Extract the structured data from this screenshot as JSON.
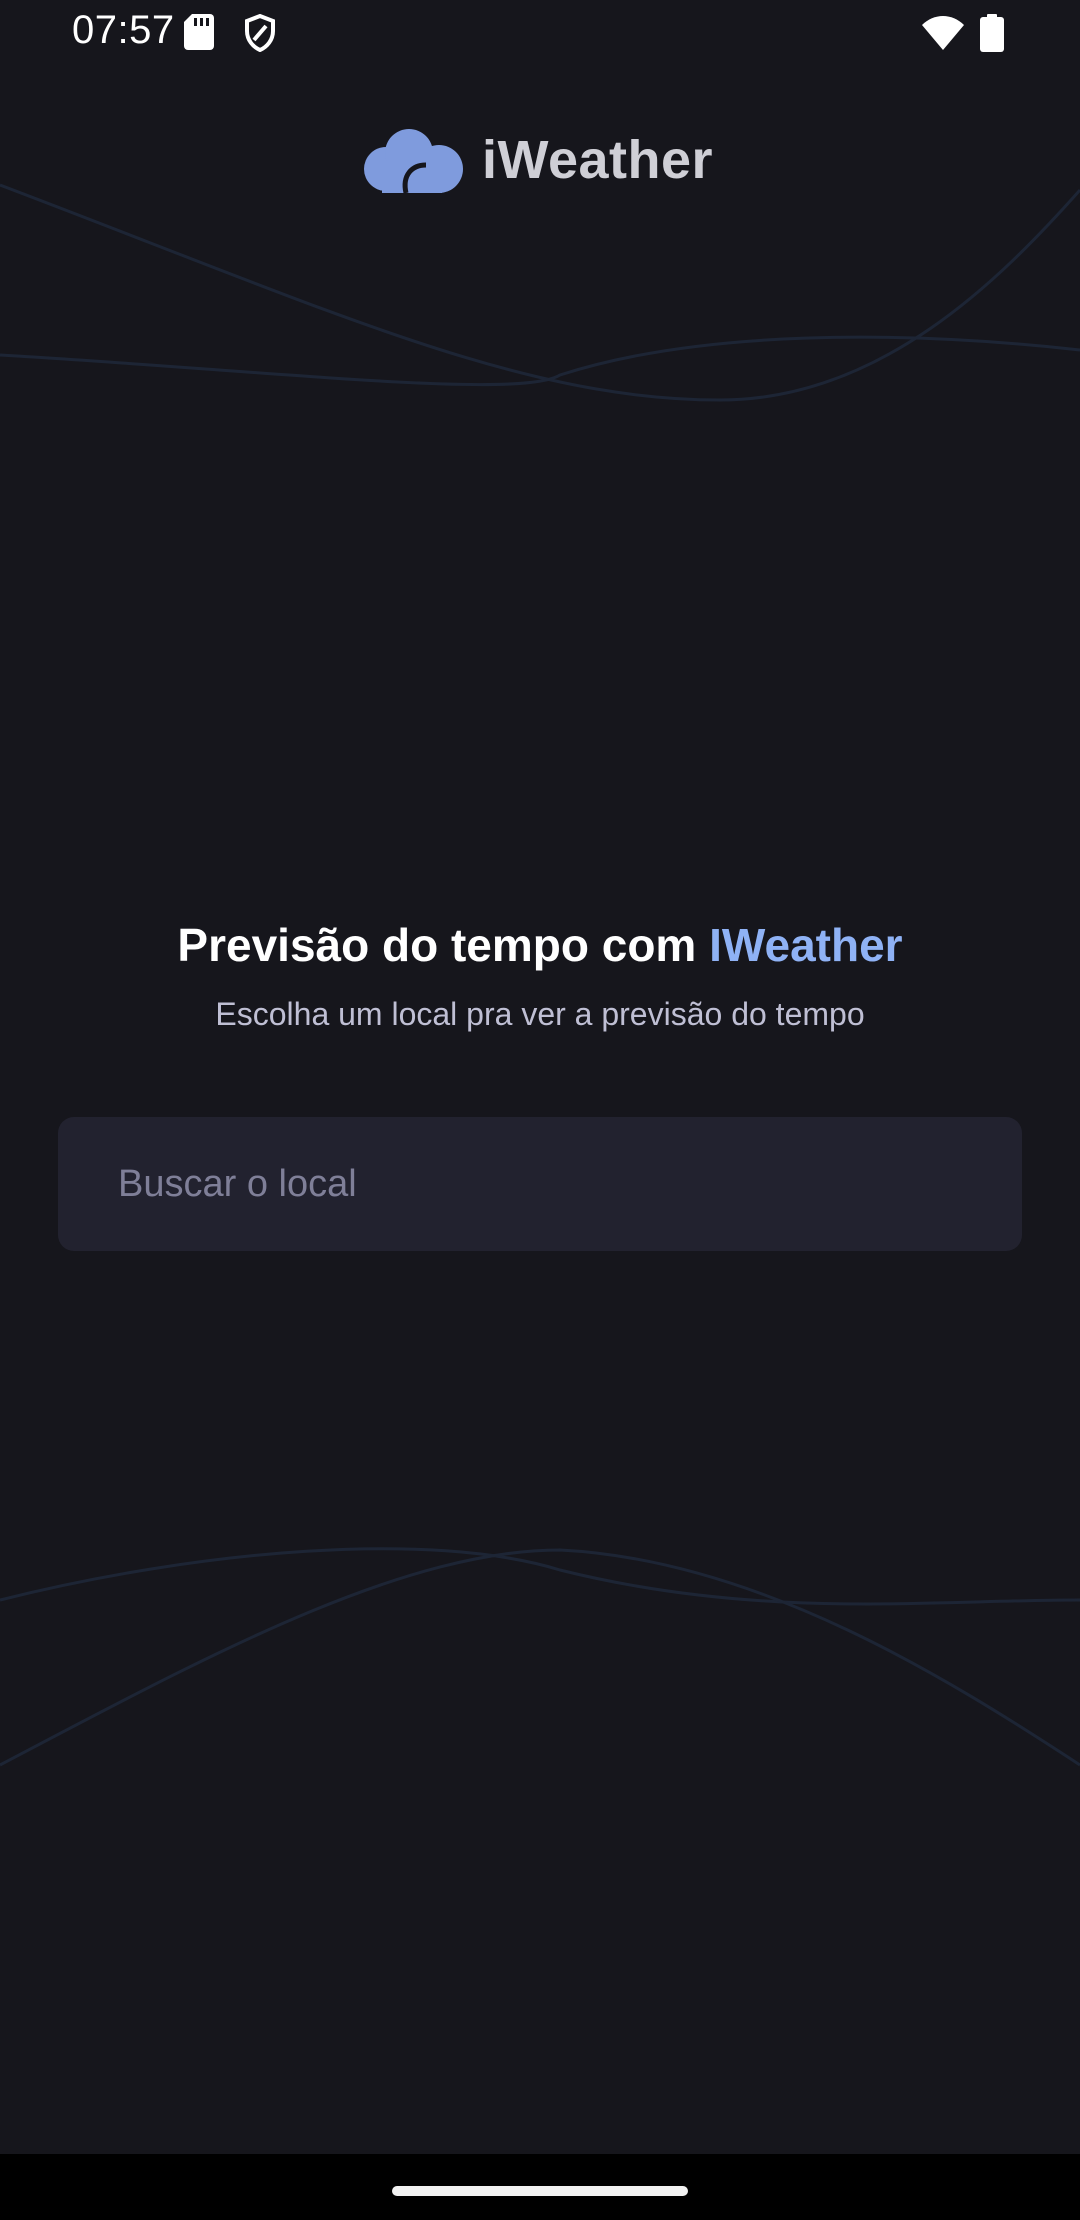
{
  "status_bar": {
    "time": "07:57",
    "icons": [
      "sd-card-icon",
      "shield-icon",
      "wifi-icon",
      "battery-icon"
    ]
  },
  "logo": {
    "text": "iWeather",
    "icon": "cloud-logo-icon"
  },
  "headline": {
    "prefix": "Previsão do tempo com ",
    "accent": "IWeather"
  },
  "subtitle": "Escolha um local pra ver a previsão do tempo",
  "search": {
    "placeholder": "Buscar o local",
    "value": ""
  },
  "colors": {
    "background": "#16161c",
    "accent": "#8fb2f5",
    "input_background": "#22222f",
    "logo_icon": "#8fb2f5"
  }
}
